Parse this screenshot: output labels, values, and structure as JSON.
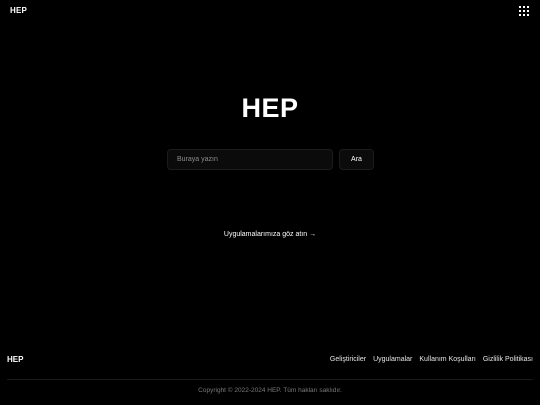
{
  "header": {
    "logo": "HEP",
    "apps_icon": "grid-icon"
  },
  "hero": {
    "title": "HEP"
  },
  "search": {
    "placeholder": "Buraya yazın",
    "value": "",
    "button_label": "Ara"
  },
  "apps_link": {
    "label": "Uygulamalarımıza göz atın →"
  },
  "footer": {
    "logo": "HEP",
    "links": [
      {
        "label": "Geliştiriciler"
      },
      {
        "label": "Uygulamalar"
      },
      {
        "label": "Kullanım Koşulları"
      },
      {
        "label": "Gizlilik Politikası"
      }
    ],
    "copyright": "Copyright © 2022-2024 HEP. Tüm hakları saklıdır."
  }
}
